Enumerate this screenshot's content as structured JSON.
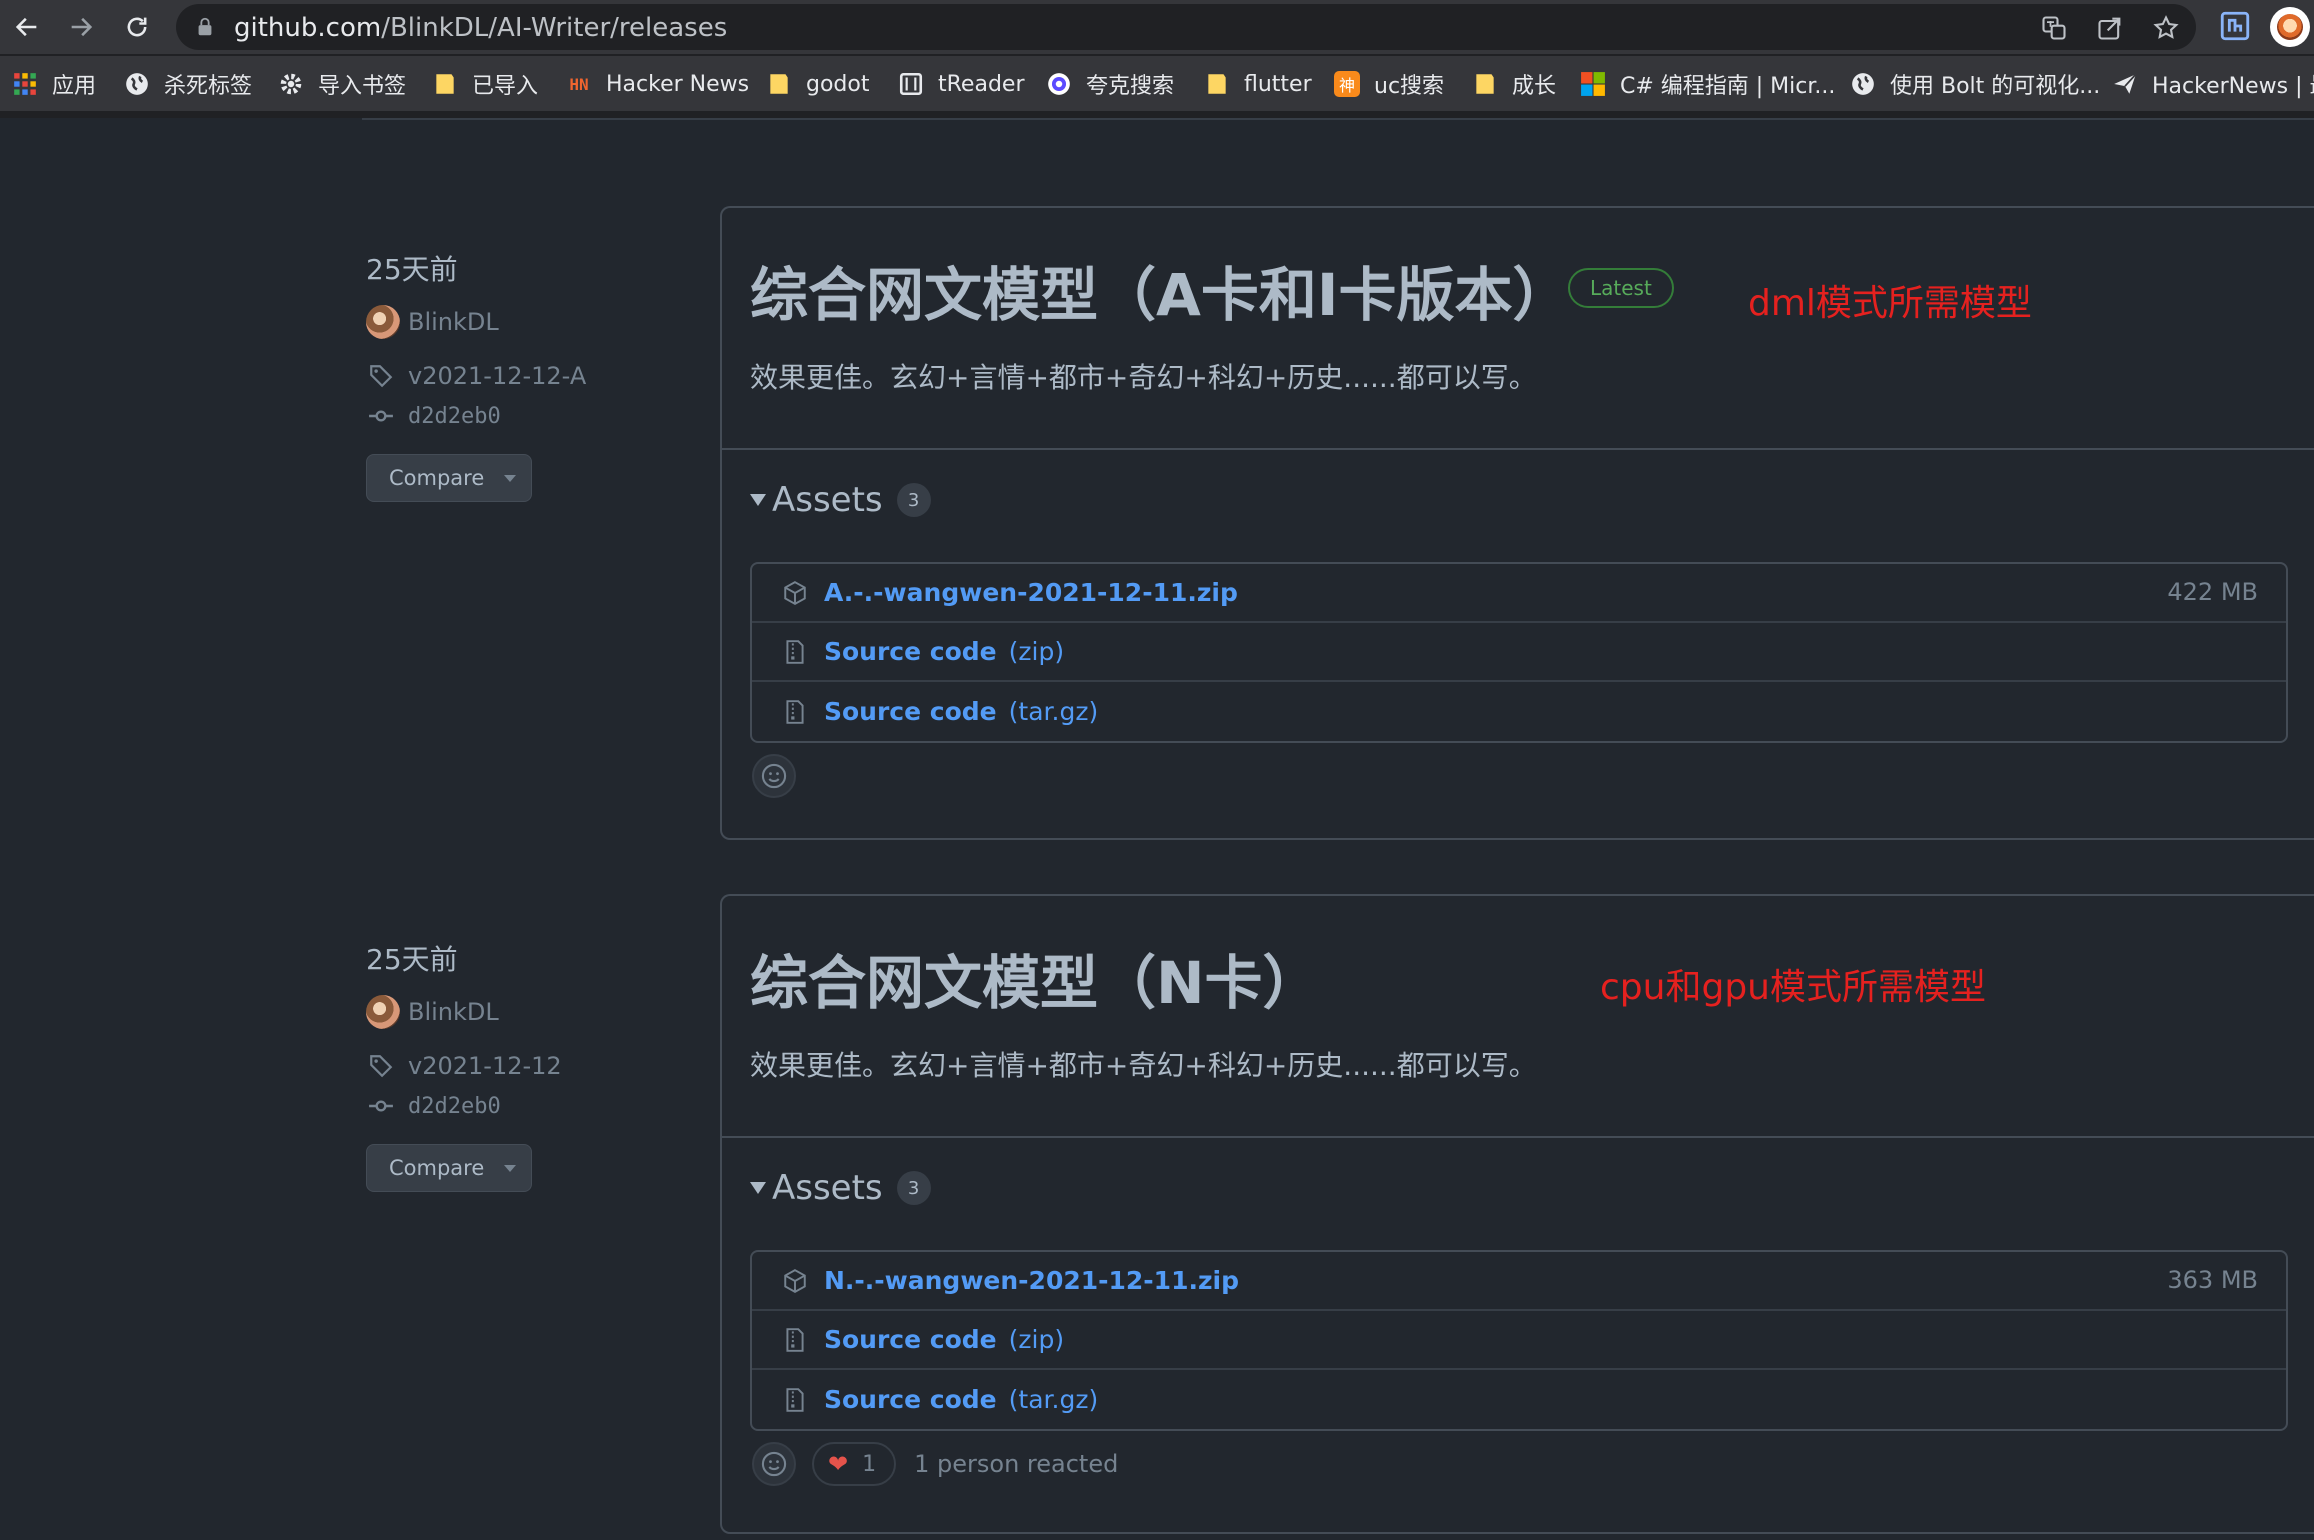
{
  "browser": {
    "url_host": "github.com",
    "url_path": "/BlinkDL/AI-Writer/releases",
    "bookmarks": [
      "应用",
      "杀死标签",
      "导入书签",
      "已导入",
      "Hacker News",
      "godot",
      "tReader",
      "夸克搜索",
      "flutter",
      "uc搜索",
      "成长",
      "C# 编程指南 | Micr...",
      "使用 Bolt 的可视化...",
      "HackerNews | 最"
    ],
    "hn_badge": "HN",
    "uc_badge": "神"
  },
  "releases": [
    {
      "date": "25天前",
      "author": "BlinkDL",
      "tag": "v2021-12-12-A",
      "commit": "d2d2eb0",
      "compare_label": "Compare",
      "title": "综合网文模型（A卡和I卡版本）",
      "latest_label": "Latest",
      "annotation": "dml模式所需模型",
      "description": "效果更佳。玄幻+言情+都市+奇幻+科幻+历史......都可以写。",
      "assets_label": "Assets",
      "assets_count": "3",
      "assets": [
        {
          "name": "A.-.-wangwen-2021-12-11.zip",
          "size": "422 MB"
        },
        {
          "name": "Source code",
          "ext": "(zip)"
        },
        {
          "name": "Source code",
          "ext": "(tar.gz)"
        }
      ]
    },
    {
      "date": "25天前",
      "author": "BlinkDL",
      "tag": "v2021-12-12",
      "commit": "d2d2eb0",
      "compare_label": "Compare",
      "title": "综合网文模型（N卡）",
      "annotation": "cpu和gpu模式所需模型",
      "description": "效果更佳。玄幻+言情+都市+奇幻+科幻+历史......都可以写。",
      "assets_label": "Assets",
      "assets_count": "3",
      "assets": [
        {
          "name": "N.-.-wangwen-2021-12-11.zip",
          "size": "363 MB"
        },
        {
          "name": "Source code",
          "ext": "(zip)"
        },
        {
          "name": "Source code",
          "ext": "(tar.gz)"
        }
      ],
      "reaction_count": "1",
      "reaction_text": "1 person reacted"
    }
  ],
  "colors": {
    "background": "#22272e",
    "link": "#539bf5",
    "annotation": "#e5211f",
    "latest_badge": "#57ab5a"
  }
}
